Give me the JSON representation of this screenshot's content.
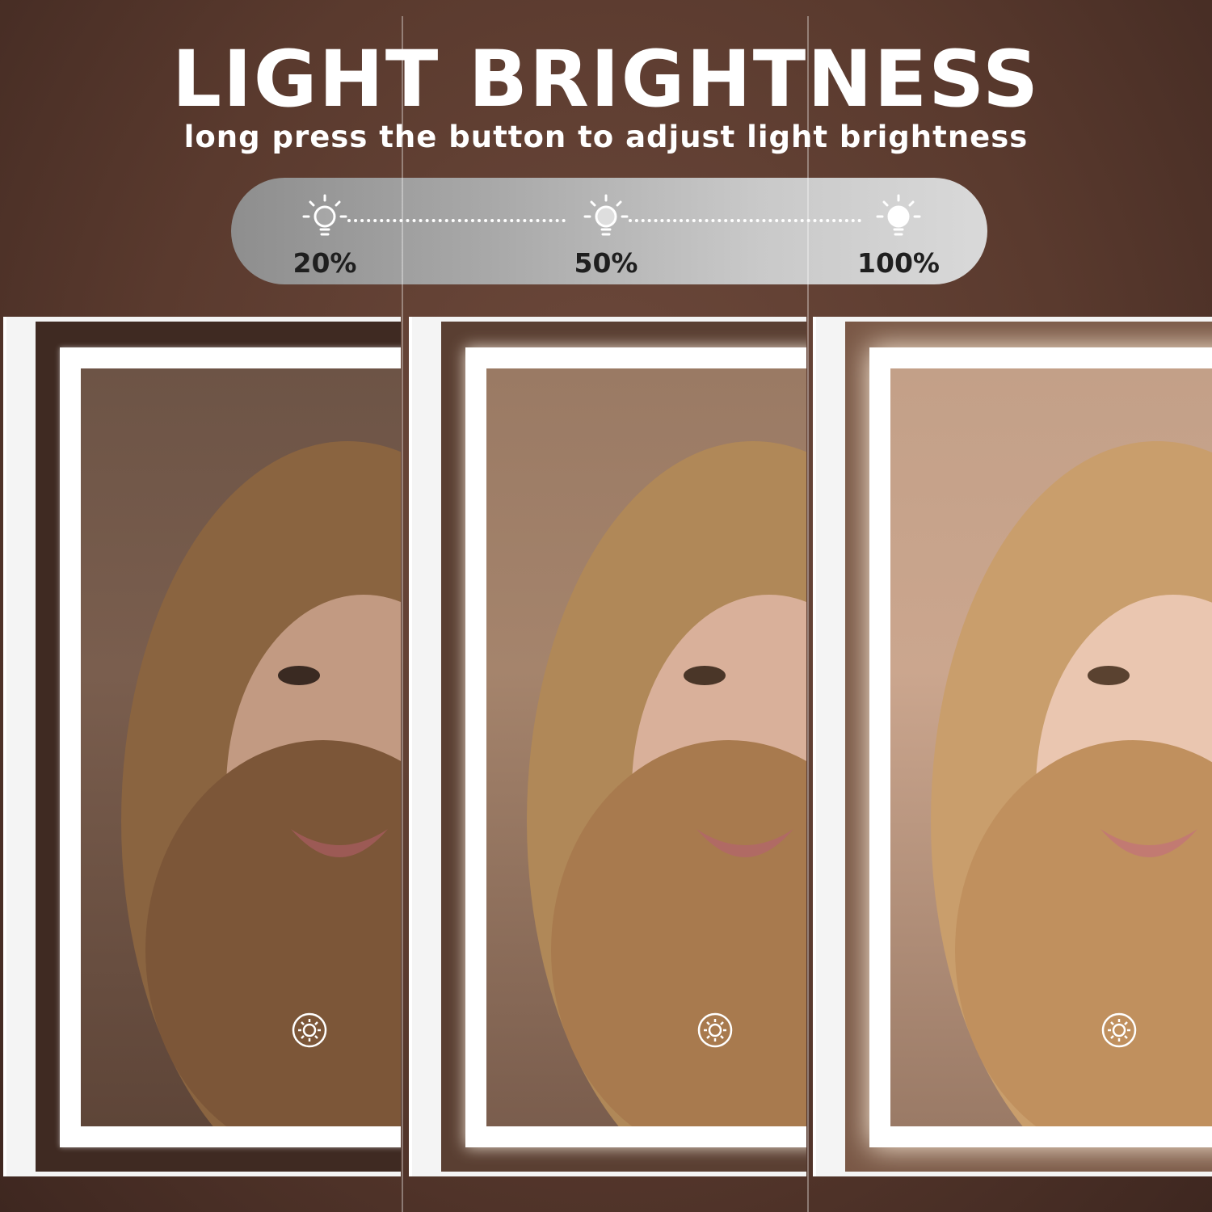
{
  "header": {
    "title": "LIGHT BRIGHTNESS",
    "subtitle": "long press the button to adjust light brightness"
  },
  "brightness_scale": {
    "levels": [
      {
        "label": "20%",
        "value": 20,
        "icon": "lightbulb-icon"
      },
      {
        "label": "50%",
        "value": 50,
        "icon": "lightbulb-icon"
      },
      {
        "label": "100%",
        "value": 100,
        "icon": "lightbulb-icon"
      }
    ]
  },
  "mirror_panels": [
    {
      "brightness": 20,
      "touch_icon": "sun-touch-icon"
    },
    {
      "brightness": 50,
      "touch_icon": "sun-touch-icon"
    },
    {
      "brightness": 100,
      "touch_icon": "sun-touch-icon"
    }
  ],
  "colors": {
    "background": "#5a3a2e",
    "led": "#ffffff",
    "text": "#ffffff",
    "scale_text": "#1f1f1f"
  }
}
